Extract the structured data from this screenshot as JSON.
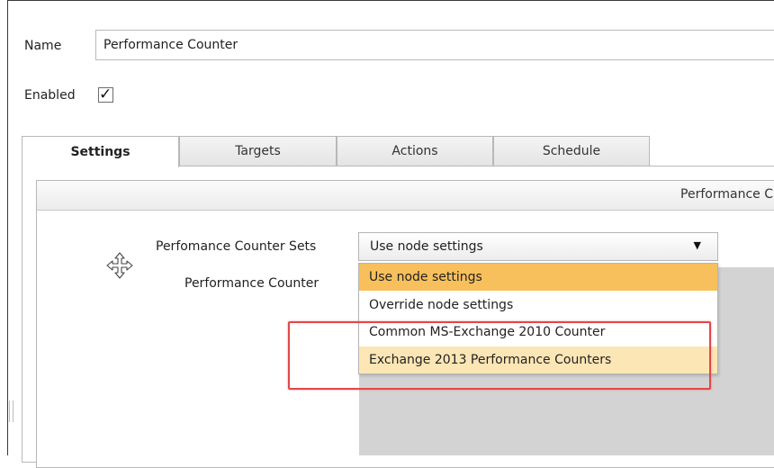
{
  "form": {
    "name_label": "Name",
    "name_value": "Performance Counter",
    "enabled_label": "Enabled",
    "enabled_checked": true,
    "check_mark": "✓"
  },
  "tabs": [
    {
      "label": "Settings",
      "active": true
    },
    {
      "label": "Targets",
      "active": false
    },
    {
      "label": "Actions",
      "active": false
    },
    {
      "label": "Schedule",
      "active": false
    }
  ],
  "panel": {
    "title": "Performance C"
  },
  "fields": {
    "counter_sets_label": "Perfomance Counter Sets",
    "counter_label": "Performance Counter"
  },
  "select": {
    "value": "Use node settings",
    "arrow": "▼",
    "options": [
      {
        "label": "Use node settings",
        "state": "selected"
      },
      {
        "label": "Override node settings",
        "state": "normal"
      },
      {
        "label": "Common MS-Exchange 2010 Counter",
        "state": "normal"
      },
      {
        "label": "Exchange 2013 Performance Counters",
        "state": "hover"
      }
    ]
  },
  "colors": {
    "selected_option": "#f8c05c",
    "hover_option": "#fde6b5",
    "highlight_border": "#e2474a"
  },
  "icons": {
    "move": "move-icon"
  }
}
